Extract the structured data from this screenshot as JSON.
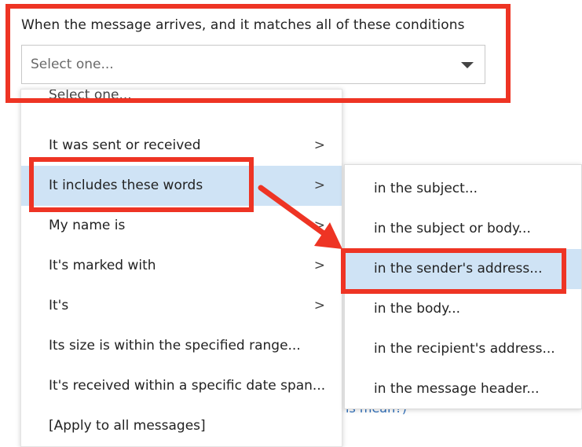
{
  "condition": {
    "label": "When the message arrives, and it matches all of these conditions",
    "select_value": "Select one..."
  },
  "menu": {
    "partial_top_item": "Select one...",
    "items": [
      {
        "label": "It was sent or received",
        "has_submenu": true
      },
      {
        "label": "It includes these words",
        "has_submenu": true,
        "highlighted": true
      },
      {
        "label": "My name is",
        "has_submenu": true
      },
      {
        "label": "It's marked with",
        "has_submenu": true
      },
      {
        "label": "It's",
        "has_submenu": true
      },
      {
        "label": "Its size is within the specified range...",
        "has_submenu": false
      },
      {
        "label": "It's received within a specific date span...",
        "has_submenu": false
      },
      {
        "label": "[Apply to all messages]",
        "has_submenu": false
      }
    ],
    "chevron_glyph": ">"
  },
  "submenu": {
    "items": [
      {
        "label": "in the subject..."
      },
      {
        "label": "in the subject or body..."
      },
      {
        "label": "in the sender's address...",
        "highlighted": true
      },
      {
        "label": "in the body..."
      },
      {
        "label": "in the recipient's address..."
      },
      {
        "label": "in the message header..."
      }
    ]
  },
  "background": {
    "partial_link_text": "is mean?)"
  },
  "colors": {
    "annotation_red": "#ee3424",
    "highlight_blue": "#cfe3f5",
    "link_blue": "#2f6fba"
  }
}
